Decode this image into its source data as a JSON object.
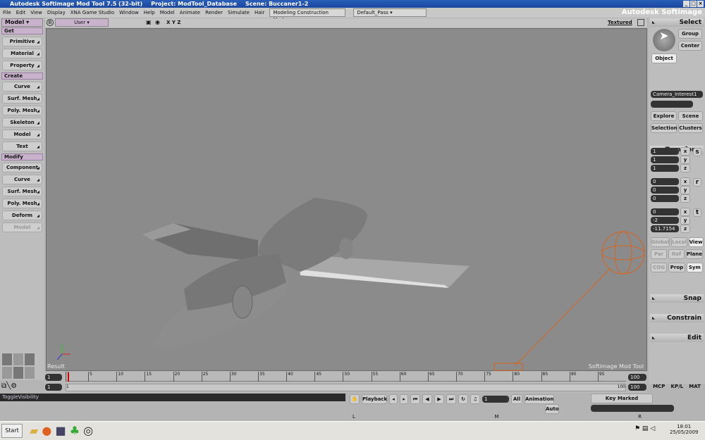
{
  "window": {
    "title": "Autodesk Softimage Mod Tool 7.5 (32-bit)",
    "project": "Project: ModTool_Database",
    "scene": "Scene: Buccaner1-2",
    "brand": "Autodesk Softimage"
  },
  "menu": [
    "File",
    "Edit",
    "View",
    "Display",
    "XNA Game Studio",
    "Window",
    "Help",
    "Model",
    "Animate",
    "Render",
    "Simulate",
    "Hair"
  ],
  "mode_dropdown": "Modeling Construction Mode",
  "pass_dropdown": "Default_Pass",
  "left": {
    "module": "Model",
    "sections": [
      {
        "title": "Get",
        "items": [
          "Primitive",
          "Material",
          "Property"
        ]
      },
      {
        "title": "Create",
        "items": [
          "Curve",
          "Surf. Mesh",
          "Poly. Mesh",
          "Skeleton",
          "Model",
          "Text"
        ]
      },
      {
        "title": "Modify",
        "items": [
          "Component",
          "Curve",
          "Surf. Mesh",
          "Poly. Mesh",
          "Deform",
          "Model"
        ]
      }
    ]
  },
  "viewport": {
    "camera": "User",
    "axes": "X Y Z",
    "shading": "Textured",
    "label_bl": "Result",
    "label_br": "Softimage Mod Tool",
    "view_letter": "B"
  },
  "right": {
    "select": "Select",
    "group": "Group",
    "center": "Center",
    "object": "Object",
    "selected_name": "Camera_Interest1",
    "explore": "Explore",
    "scene": "Scene",
    "selection": "Selection",
    "clusters": "Clusters",
    "transform": "Transform",
    "scale": [
      "1",
      "1",
      "1"
    ],
    "rotate": [
      "0",
      "0",
      "0"
    ],
    "translate": [
      "0",
      "-2",
      "-11.7154"
    ],
    "axis": [
      "x",
      "y",
      "z"
    ],
    "srt": [
      "s",
      "r",
      "t"
    ],
    "ref_row1": [
      "Global",
      "Local",
      "View"
    ],
    "ref_row2": [
      "Par",
      "Ref",
      "Plane"
    ],
    "ref_row3": [
      "COG",
      "Prop",
      "Sym"
    ],
    "snap": "Snap",
    "constrain": "Constrain",
    "edit": "Edit"
  },
  "timeline": {
    "start": "1",
    "end": "100",
    "range_start": "1",
    "range_end": "100",
    "ticks": [
      "1",
      "5",
      "10",
      "15",
      "20",
      "25",
      "30",
      "35",
      "40",
      "45",
      "50",
      "55",
      "60",
      "65",
      "70",
      "75",
      "80",
      "85",
      "90",
      "95"
    ],
    "current": "1",
    "tabs": [
      "MCP",
      "KP/L",
      "MAT"
    ]
  },
  "bottom": {
    "command": "ToggleVisibility",
    "playback": "Playback",
    "frame": "1",
    "all": "All",
    "animation": "Animation",
    "auto": "Auto",
    "key_marked": "Key Marked Parameters",
    "lmr": [
      "L",
      "M",
      "R"
    ]
  },
  "taskbar": {
    "start": "Start",
    "time": "18:01",
    "date": "25/05/2009"
  }
}
